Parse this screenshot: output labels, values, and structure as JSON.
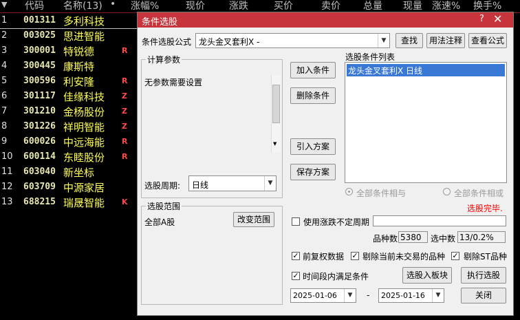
{
  "header": {
    "arrow": "▼",
    "code": "代码",
    "name": "名称(13)",
    "dot": "•",
    "change_pct": "涨幅%",
    "price": "现价",
    "change": "涨跌",
    "bid": "买价",
    "ask": "卖价",
    "volume": "总量",
    "cur_vol": "现量",
    "speed": "涨速%",
    "turnover": "换手%"
  },
  "rows": [
    {
      "n": "1",
      "code": "001311",
      "name": "多利科技",
      "flag": ""
    },
    {
      "n": "2",
      "code": "003025",
      "name": "思进智能",
      "flag": ""
    },
    {
      "n": "3",
      "code": "300001",
      "name": "特锐德",
      "flag": "R"
    },
    {
      "n": "4",
      "code": "300445",
      "name": "康斯特",
      "flag": ""
    },
    {
      "n": "5",
      "code": "300596",
      "name": "利安隆",
      "flag": "R"
    },
    {
      "n": "6",
      "code": "301117",
      "name": "佳缘科技",
      "flag": "Z"
    },
    {
      "n": "7",
      "code": "301210",
      "name": "金杨股份",
      "flag": "Z"
    },
    {
      "n": "8",
      "code": "301226",
      "name": "祥明智能",
      "flag": "Z"
    },
    {
      "n": "9",
      "code": "600026",
      "name": "中远海能",
      "flag": "R"
    },
    {
      "n": "10",
      "code": "600114",
      "name": "东睦股份",
      "flag": "R"
    },
    {
      "n": "11",
      "code": "603040",
      "name": "新坐标",
      "flag": ""
    },
    {
      "n": "12",
      "code": "603709",
      "name": "中源家居",
      "flag": ""
    },
    {
      "n": "13",
      "code": "688215",
      "name": "瑞晟智能",
      "flag": "K"
    }
  ],
  "dialog": {
    "title": "条件选股",
    "help": "?",
    "close": "✕",
    "formula_label": "条件选股公式",
    "formula_value": "龙头金叉套利X -",
    "find": "查找",
    "usage": "用法注释",
    "view": "查看公式",
    "params_title": "计算参数",
    "params_text": "无参数需要设置",
    "add_cond": "加入条件",
    "del_cond": "删除条件",
    "import_plan": "引入方案",
    "save_plan": "保存方案",
    "cond_list_title": "选股条件列表",
    "cond_items": [
      "龙头金叉套利X  日线"
    ],
    "period_label": "选股周期:",
    "period_value": "日线",
    "all_and": "全部条件相与",
    "all_or": "全部条件相或",
    "done": "选股完毕.",
    "range_title": "选股范围",
    "range_value": "全部A股",
    "change_range": "改变范围",
    "use_var_period": "使用涨跌不定周期",
    "count_label": "品种数",
    "count_value": "5380",
    "hit_label": "选中数",
    "hit_value": "13/0.2%",
    "fq": "前复权数据",
    "remove_untraded": "剔除当前未交易的品种",
    "remove_st": "剔除ST品种",
    "time_range": "时间段内满足条件",
    "to_block": "选股入板块",
    "execute": "执行选股",
    "date_from": "2025-01-06",
    "dash": "-",
    "date_to": "2025-01-16",
    "close_btn": "关闭",
    "check_mark": "✓"
  },
  "colors": {
    "title_bar": "#c8343c",
    "code": "#e8e8b0",
    "name": "#ffff55",
    "flag": "#ff4a4a",
    "done": "#ff0000",
    "selected": "#3a78d6"
  }
}
